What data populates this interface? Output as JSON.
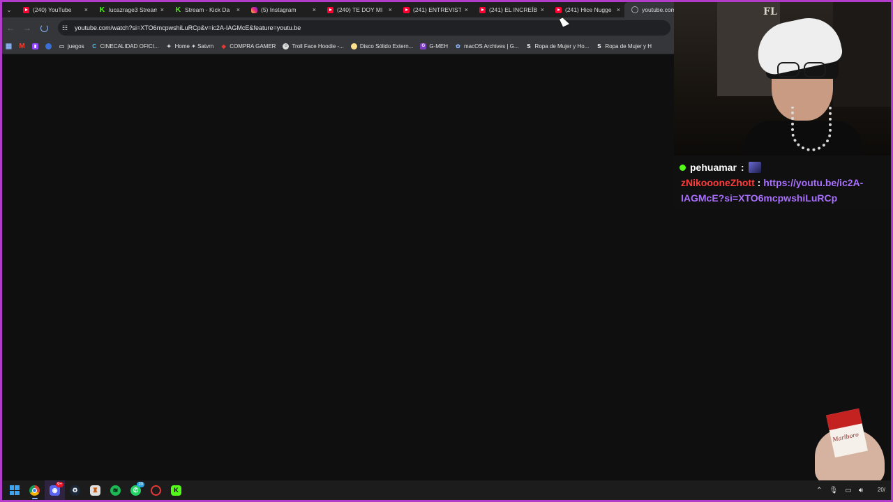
{
  "browser": {
    "tabs": [
      {
        "title": "(240) YouTube",
        "icon": "youtube-icon"
      },
      {
        "title": "lucazrage3 Stream",
        "icon": "kick-icon"
      },
      {
        "title": "Stream - Kick Da",
        "icon": "kick-icon"
      },
      {
        "title": "(5) Instagram",
        "icon": "instagram-icon"
      },
      {
        "title": "(240) TE DOY MI",
        "icon": "youtube-icon"
      },
      {
        "title": "(241) ENTREVISTA",
        "icon": "youtube-icon"
      },
      {
        "title": "(241) EL INCREÍBL",
        "icon": "youtube-icon"
      },
      {
        "title": "(241) Hice Nugge",
        "icon": "youtube-icon"
      },
      {
        "title": "youtube.com",
        "icon": "globe-icon"
      }
    ],
    "tab_close_glyph": "×",
    "url": "youtube.com/watch?si=XTO6mcpwshiLuRCp&v=ic2A-IAGMcE&feature=youtu.be",
    "bookmarks": [
      {
        "label": "",
        "icon": "gmail-icon"
      },
      {
        "label": "",
        "icon": "twitch-icon"
      },
      {
        "label": "",
        "icon": "profile-icon"
      },
      {
        "label": "juegos",
        "icon": "folder-icon"
      },
      {
        "label": "CINECALIDAD OFICI...",
        "icon": "cinecalidad-icon"
      },
      {
        "label": "Home ✦ Satvrn",
        "icon": "satvrn-icon"
      },
      {
        "label": "COMPRA GAMER",
        "icon": "compragamer-icon"
      },
      {
        "label": "Troll Face Hoodie -...",
        "icon": "troll-icon"
      },
      {
        "label": "Disco Sólido Extern...",
        "icon": "disk-icon"
      },
      {
        "label": "G-MEH",
        "icon": "gmeh-icon"
      },
      {
        "label": "macOS Archives | G...",
        "icon": "macos-icon"
      },
      {
        "label": "Ropa de Mujer y Ho...",
        "icon": "shein-icon"
      },
      {
        "label": "Ropa de Mujer y H",
        "icon": "shein-icon"
      }
    ]
  },
  "stream": {
    "wall_text": "FL",
    "chat": [
      {
        "user": "pehuamar",
        "separator": ":",
        "message": "",
        "user_color": "#ffffff"
      },
      {
        "user": "zNikoooneZhott",
        "separator": ":",
        "message": "https://youtu.be/ic2A-IAGMcE?si=XTO6mcpwshiLuRCp",
        "user_color": "#ff3b3b"
      }
    ],
    "pack_label": "Marlboro"
  },
  "taskbar": {
    "apps": [
      "windows-start",
      "chrome",
      "discord",
      "steam",
      "fiddler",
      "spotify",
      "whatsapp",
      "speedrun",
      "kick"
    ],
    "discord_badge": "9+",
    "whatsapp_badge": "20",
    "clock": "20/"
  },
  "colors": {
    "frame": "#b13cc9",
    "kick": "#53fc18",
    "youtube": "#ff0033",
    "link": "#a970ff",
    "chat_user_2": "#ff3b3b"
  }
}
